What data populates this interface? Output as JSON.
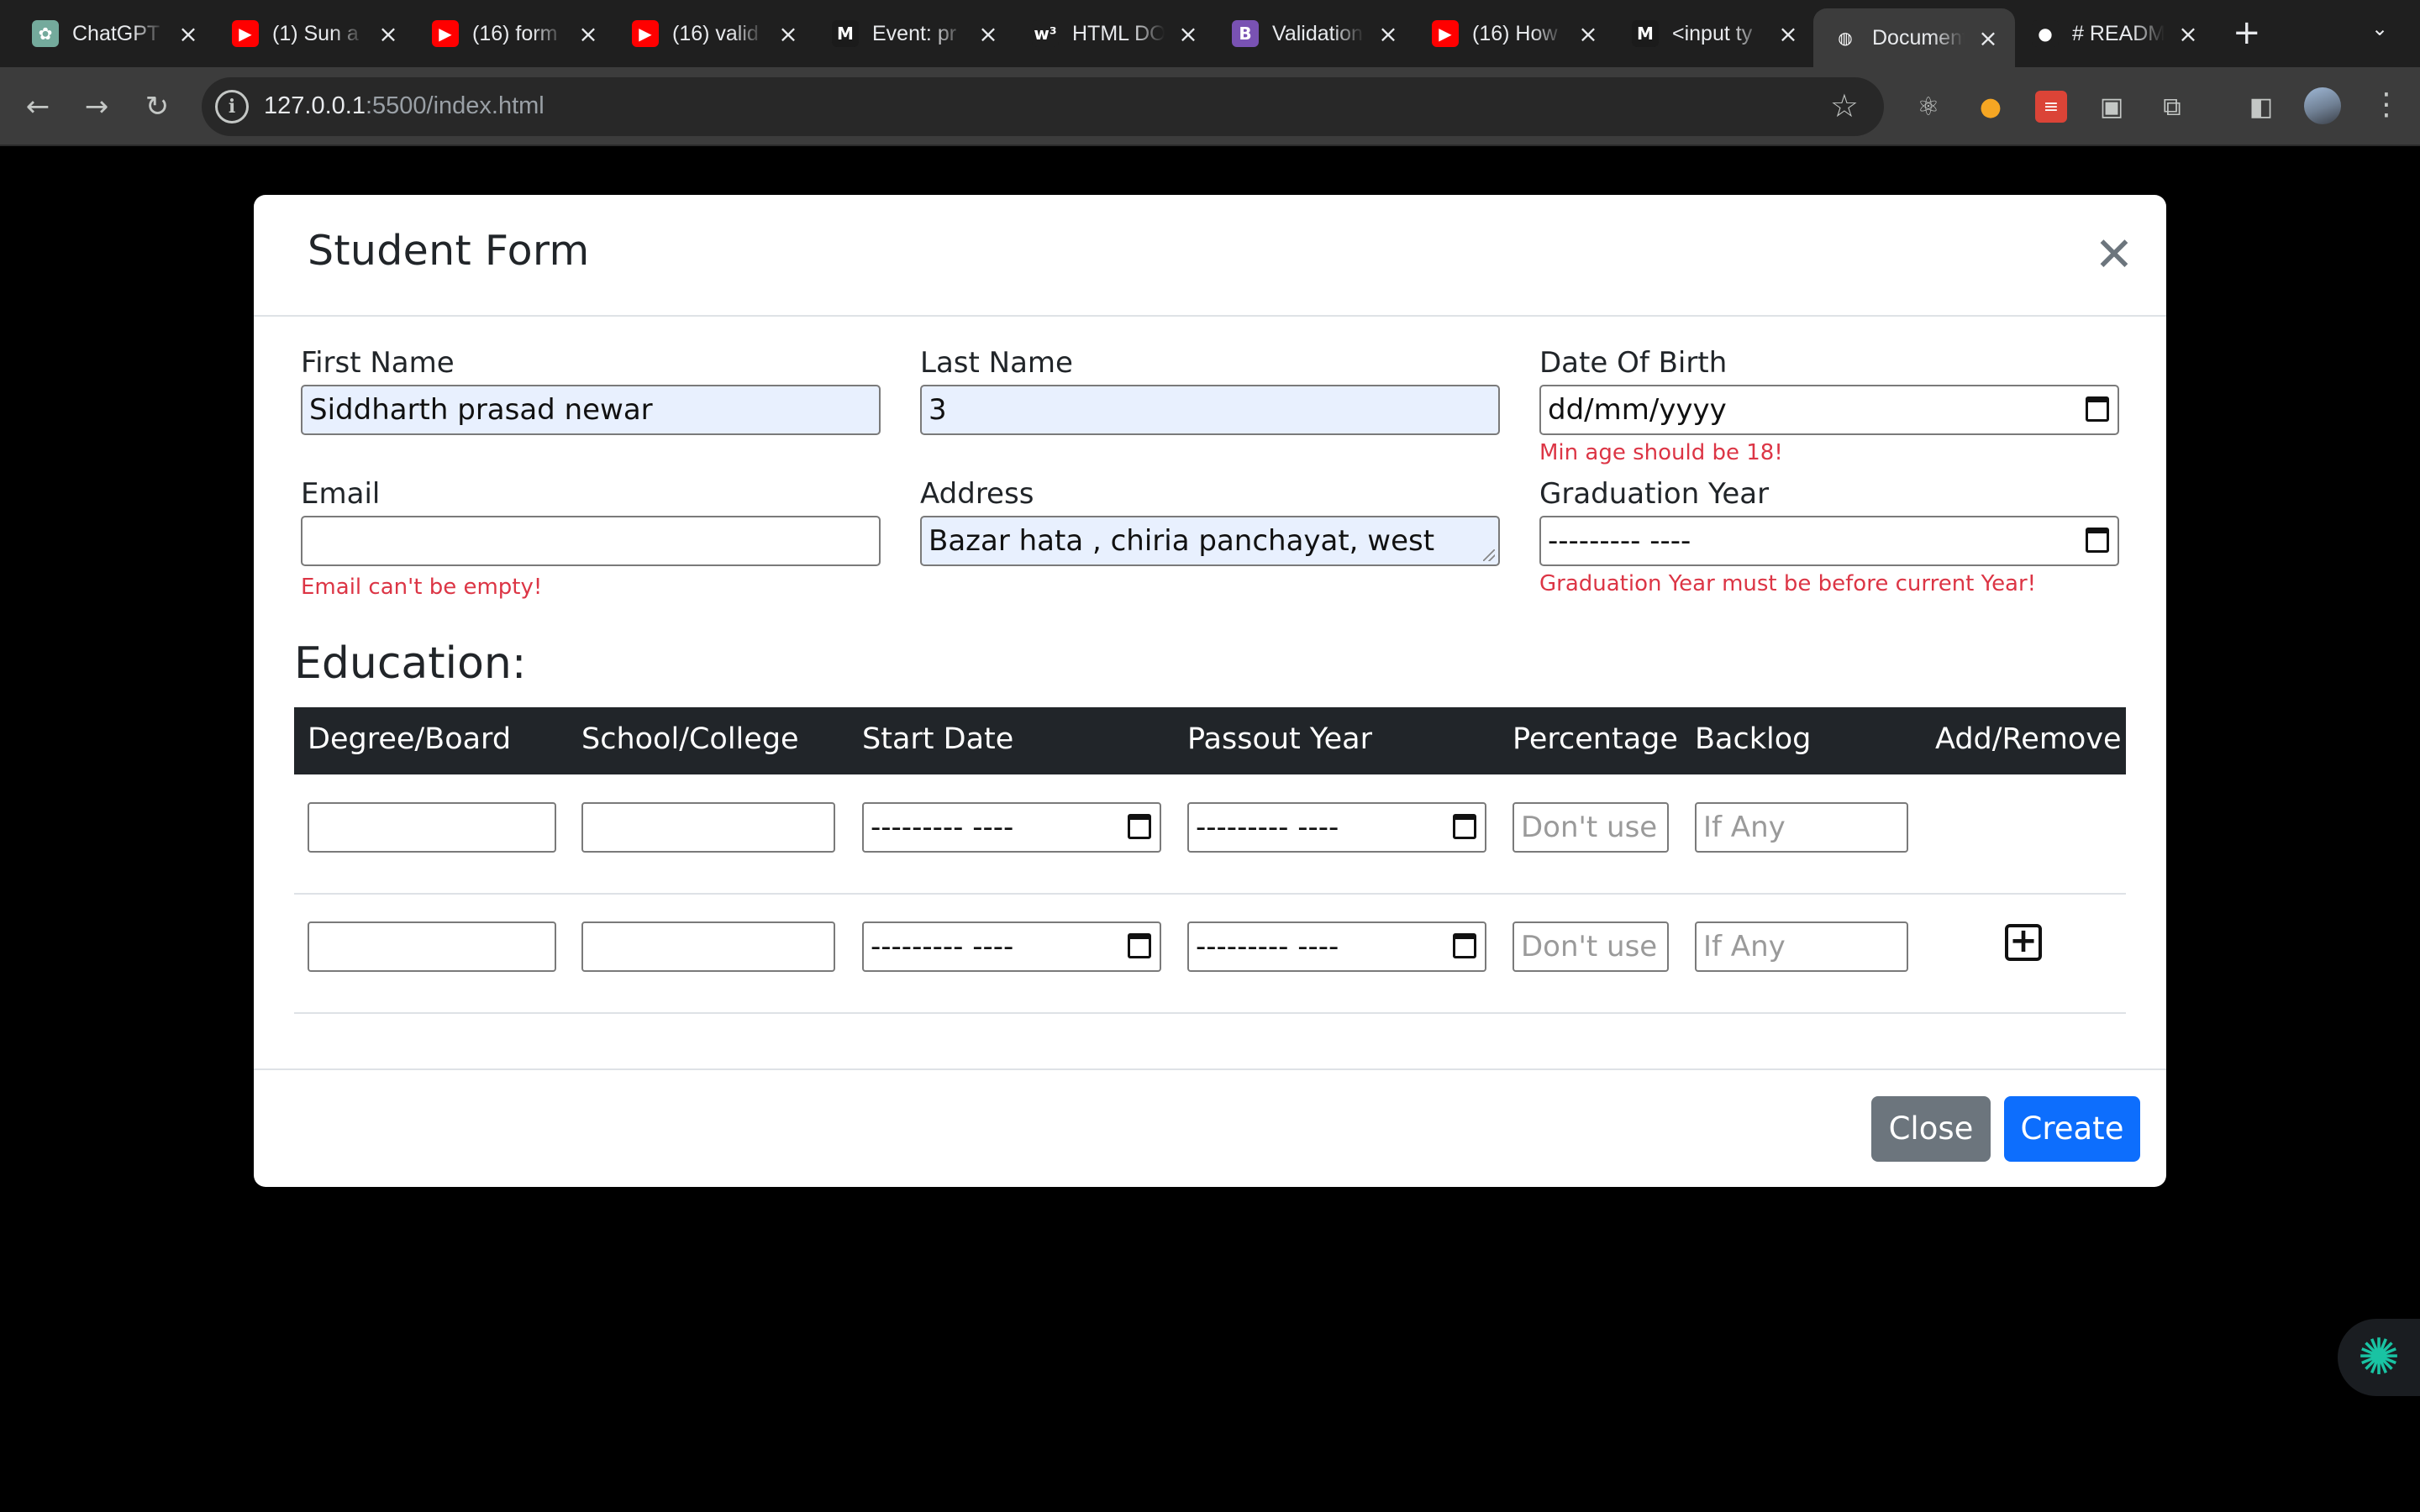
{
  "browser": {
    "tabs": [
      {
        "title": "ChatGPT",
        "icon": "chatgpt-icon",
        "color": "#74aa9c",
        "glyph": "✿"
      },
      {
        "title": "(1) Sun a",
        "icon": "youtube-icon",
        "color": "#ff0000",
        "glyph": "▶"
      },
      {
        "title": "(16) form",
        "icon": "youtube-icon",
        "color": "#ff0000",
        "glyph": "▶"
      },
      {
        "title": "(16) valid",
        "icon": "youtube-icon",
        "color": "#ff0000",
        "glyph": "▶"
      },
      {
        "title": "Event: pr",
        "icon": "mdn-icon",
        "color": "#1b1b1b",
        "glyph": "M"
      },
      {
        "title": "HTML DO",
        "icon": "w3schools-icon",
        "color": "#1f1f1f",
        "glyph": "w³"
      },
      {
        "title": "Validation",
        "icon": "bootstrap-icon",
        "color": "#7952b3",
        "glyph": "B"
      },
      {
        "title": "(16) How",
        "icon": "youtube-icon",
        "color": "#ff0000",
        "glyph": "▶"
      },
      {
        "title": "<input ty",
        "icon": "mdn-icon",
        "color": "#1b1b1b",
        "glyph": "M"
      },
      {
        "title": "Document",
        "icon": "globe-icon",
        "color": "#3c3c3c",
        "glyph": "◍"
      },
      {
        "title": "# READM",
        "icon": "github-icon",
        "color": "#1f1f1f",
        "glyph": "●"
      }
    ],
    "new_tab": "+",
    "url_host": "127.0.0.1",
    "url_rest": ":5500/index.html"
  },
  "form": {
    "title": "Student Form",
    "close_glyph": "✕",
    "first_name": {
      "label": "First Name",
      "value": "Siddharth prasad newar"
    },
    "last_name": {
      "label": "Last Name",
      "value": "3"
    },
    "dob": {
      "label": "Date Of Birth",
      "value": "dd/mm/yyyy",
      "error": "Min age should be 18!"
    },
    "email": {
      "label": "Email",
      "value": "",
      "error": "Email can't be empty!"
    },
    "address": {
      "label": "Address",
      "value": "Bazar hata , chiria panchayat, west"
    },
    "graduation_year": {
      "label": "Graduation Year",
      "value": "--------- ----",
      "error": "Graduation Year must be before current Year!"
    }
  },
  "education": {
    "title": "Education:",
    "columns": [
      "Degree/Board",
      "School/College",
      "Start Date",
      "Passout Year",
      "Percentage",
      "Backlog",
      "Add/Remove"
    ],
    "rows": [
      {
        "degree": "",
        "school": "",
        "start": "--------- ----",
        "passout": "--------- ----",
        "percentage_placeholder": "Don't use",
        "backlog_placeholder": "If Any"
      },
      {
        "degree": "",
        "school": "",
        "start": "--------- ----",
        "passout": "--------- ----",
        "percentage_placeholder": "Don't use",
        "backlog_placeholder": "If Any",
        "add": "+"
      }
    ]
  },
  "footer": {
    "close_label": "Close",
    "create_label": "Create"
  }
}
